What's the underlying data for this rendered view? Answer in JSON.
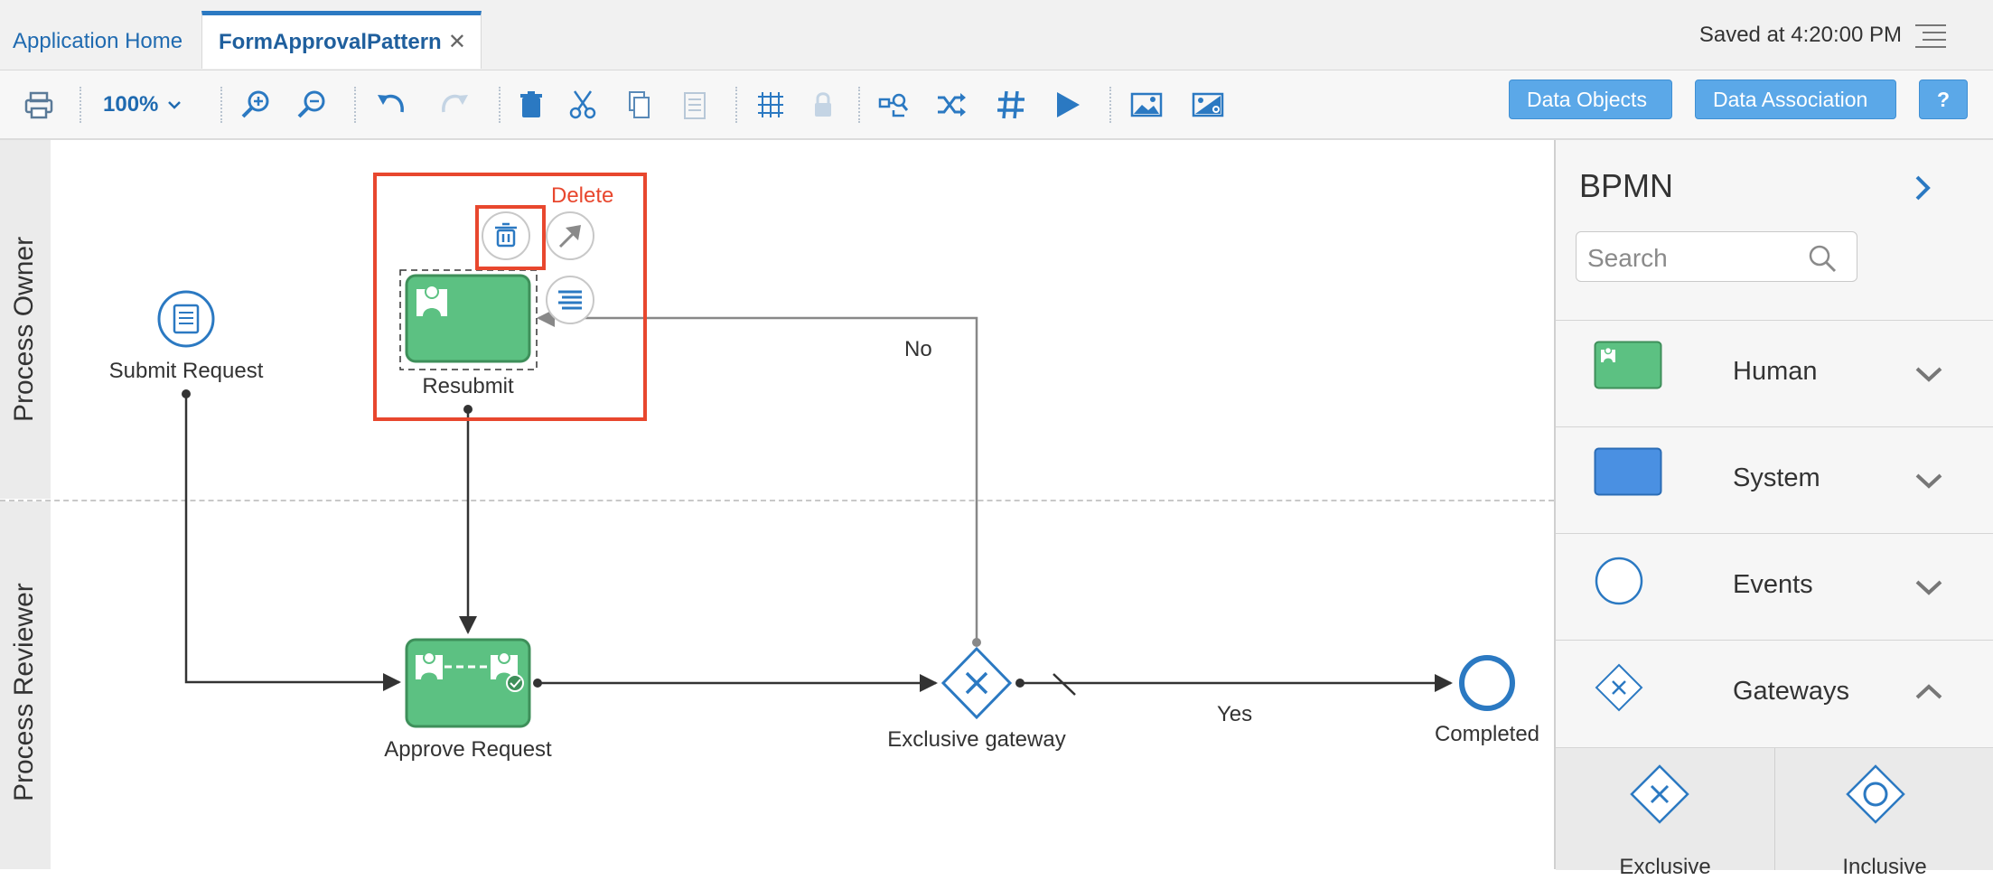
{
  "tabs": {
    "home_label": "Application Home",
    "active_label": "FormApprovalPattern",
    "close_symbol": "✕"
  },
  "status": {
    "saved_text": "Saved at 4:20:00 PM"
  },
  "toolbar": {
    "zoom_value": "100%",
    "icons": [
      "printer-icon",
      "zoom-in-icon",
      "zoom-out-icon",
      "undo-icon",
      "redo-icon",
      "delete-icon",
      "cut-icon",
      "copy-icon",
      "paste-icon",
      "grid-icon",
      "lock-icon",
      "validate-icon",
      "shuffle-icon",
      "hash-icon",
      "play-icon",
      "image-icon",
      "image-settings-icon"
    ],
    "data_objects_label": "Data Objects",
    "data_association_label": "Data Association",
    "help_label": "?"
  },
  "canvas": {
    "lanes": [
      "Process Owner",
      "Process Reviewer"
    ],
    "nodes": {
      "submit_request": "Submit Request",
      "resubmit": "Resubmit",
      "approve_request": "Approve Request",
      "exclusive_gateway": "Exclusive gateway",
      "completed": "Completed"
    },
    "flow_labels": {
      "no": "No",
      "yes": "Yes"
    },
    "context_menu": {
      "delete_label": "Delete"
    }
  },
  "palette": {
    "title": "BPMN",
    "search_placeholder": "Search",
    "categories": [
      {
        "label": "Human",
        "expanded": false
      },
      {
        "label": "System",
        "expanded": false
      },
      {
        "label": "Events",
        "expanded": false
      },
      {
        "label": "Gateways",
        "expanded": true
      }
    ],
    "gateway_items": [
      "Exclusive",
      "Inclusive"
    ]
  },
  "colors": {
    "accent_blue": "#2b79c2",
    "task_green": "#5cc182",
    "task_green_border": "#3e8f5a",
    "highlight_red": "#e8472e",
    "button_blue": "#5ba8e8"
  }
}
